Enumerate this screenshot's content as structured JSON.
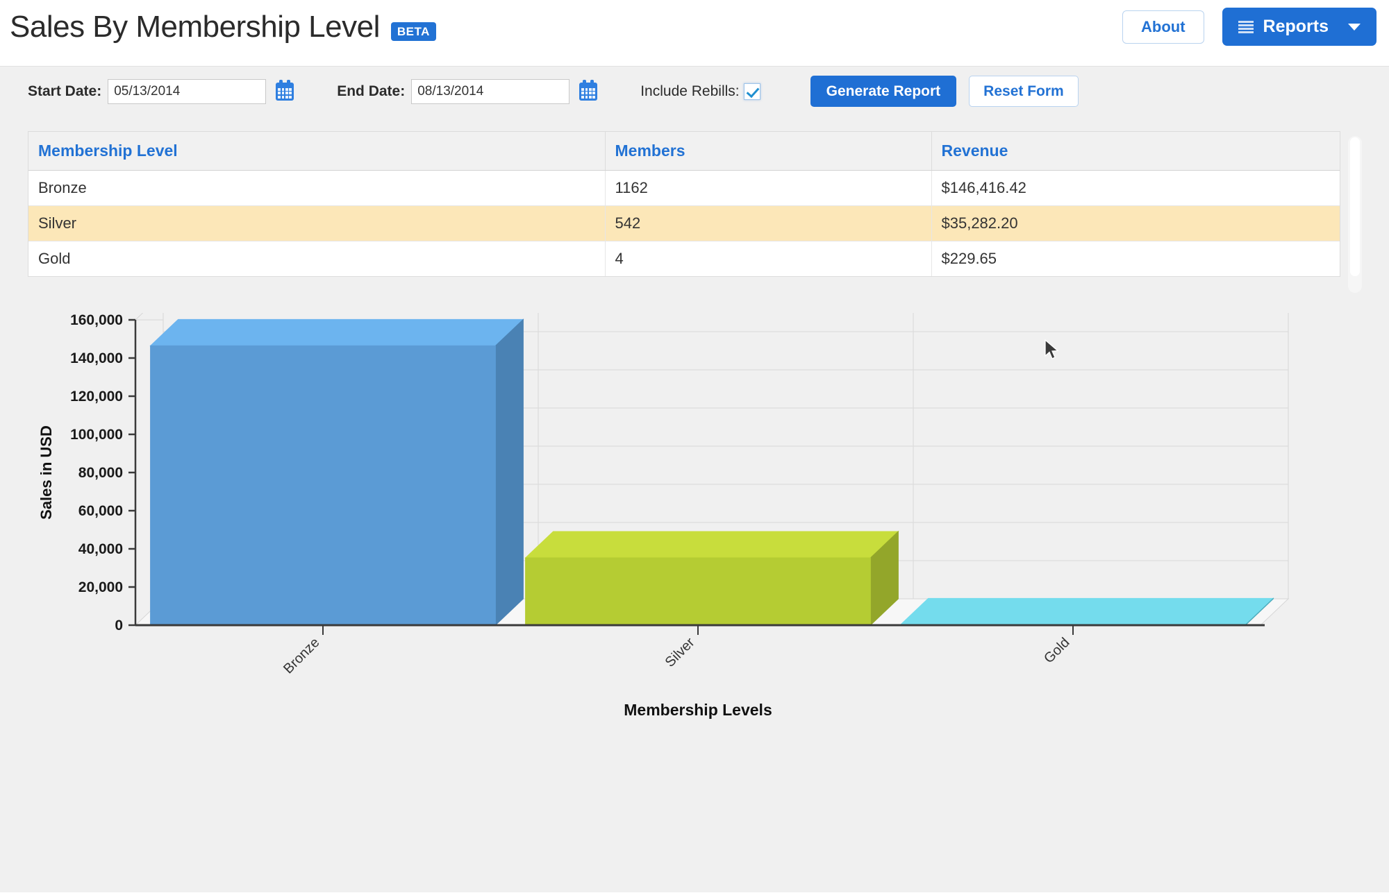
{
  "header": {
    "title": "Sales By Membership Level",
    "badge": "BETA",
    "about_label": "About",
    "reports_label": "Reports",
    "list_icon": "list-icon",
    "caret_icon": "chevron-down-icon"
  },
  "filters": {
    "start_date_label": "Start Date:",
    "start_date_value": "05/13/2014",
    "start_date_placeholder": "mm/dd/yyyy",
    "end_date_label": "End Date:",
    "end_date_value": "08/13/2014",
    "end_date_placeholder": "mm/dd/yyyy",
    "calendar_icon": "calendar-icon",
    "include_rebills_label": "Include Rebills:",
    "include_rebills_checked": true,
    "generate_label": "Generate Report",
    "reset_label": "Reset Form"
  },
  "table": {
    "columns": [
      "Membership Level",
      "Members",
      "Revenue"
    ],
    "rows": [
      {
        "level": "Bronze",
        "members": "1162",
        "revenue": "$146,416.42",
        "highlighted": false
      },
      {
        "level": "Silver",
        "members": "542",
        "revenue": "$35,282.20",
        "highlighted": true
      },
      {
        "level": "Gold",
        "members": "4",
        "revenue": "$229.65",
        "highlighted": false
      }
    ]
  },
  "chart_data": {
    "type": "bar",
    "title": "",
    "categories": [
      "Bronze",
      "Silver",
      "Gold"
    ],
    "values": [
      146416.42,
      35282.2,
      229.65
    ],
    "xlabel": "Membership Levels",
    "ylabel": "Sales in USD",
    "ylim": [
      0,
      160000
    ],
    "yticks": [
      "0",
      "20,000",
      "40,000",
      "60,000",
      "80,000",
      "100,000",
      "120,000",
      "140,000",
      "160,000"
    ],
    "ytick_values": [
      0,
      20000,
      40000,
      60000,
      80000,
      100000,
      120000,
      140000,
      160000
    ],
    "grid": true,
    "legend": "none",
    "three_d": true,
    "bar_colors": [
      "#5b9bd5",
      "#b5cc33",
      "#5bcbdd"
    ],
    "bar_top_colors": [
      "#6cb4ef",
      "#c8dd3c",
      "#74dced"
    ],
    "bar_side_colors": [
      "#4a82b4",
      "#93a62a",
      "#4cabbb"
    ],
    "xtick_rotation": -45
  },
  "colors": {
    "accent": "#1f6fd4",
    "header_text": "#2272d4",
    "highlight_row": "#fce7b8",
    "panel_bg": "#f0f0f0"
  }
}
